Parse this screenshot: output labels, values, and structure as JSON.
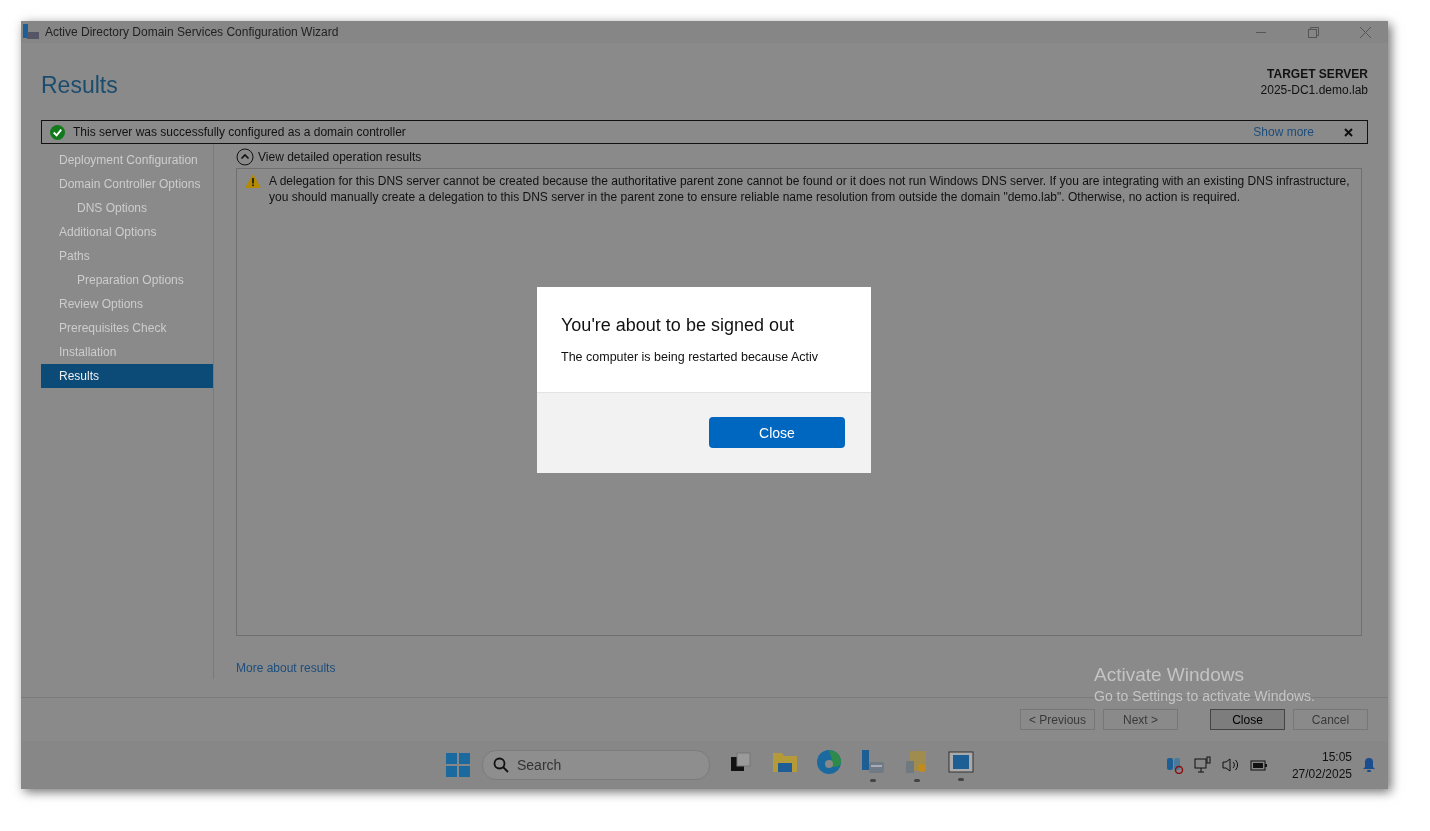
{
  "window": {
    "title": "Active Directory Domain Services Configuration Wizard"
  },
  "header": {
    "title": "Results",
    "target_label": "TARGET SERVER",
    "target_value": "2025-DC1.demo.lab"
  },
  "banner": {
    "text": "This server was successfully configured as a domain controller",
    "link": "Show more"
  },
  "steps": [
    {
      "label": "Deployment Configuration",
      "selected": false
    },
    {
      "label": "Domain Controller Options",
      "selected": false,
      "children": [
        {
          "label": "DNS Options",
          "selected": false
        }
      ]
    },
    {
      "label": "Additional Options",
      "selected": false
    },
    {
      "label": "Paths",
      "selected": false,
      "children": [
        {
          "label": "Preparation Options",
          "selected": false
        }
      ]
    },
    {
      "label": "Review Options",
      "selected": false
    },
    {
      "label": "Prerequisites Check",
      "selected": false
    },
    {
      "label": "Installation",
      "selected": false
    },
    {
      "label": "Results",
      "selected": true
    }
  ],
  "details": {
    "toggle": "View detailed operation results",
    "expanded": true,
    "messages": [
      {
        "kind": "warning",
        "text": "A delegation for this DNS server cannot be created because the authoritative parent zone cannot be found or it does not run Windows DNS server. If you are integrating with an existing DNS infrastructure, you should manually create a delegation to this DNS server in the parent zone to ensure reliable name resolution from outside the domain \"demo.lab\". Otherwise, no action is required."
      }
    ],
    "more_link": "More about results"
  },
  "buttons": [
    {
      "label": "< Previous",
      "disabled": true
    },
    {
      "label": "Next >",
      "disabled": true
    },
    {
      "label": "Close",
      "disabled": false
    },
    {
      "label": "Cancel",
      "disabled": true
    }
  ],
  "activation": {
    "title": "Activate Windows",
    "subtitle": "Go to Settings to activate Windows."
  },
  "dialog": {
    "title": "You're about to be signed out",
    "message": "The computer is being restarted because Activ",
    "button": "Close"
  },
  "taskbar": {
    "search_placeholder": "Search",
    "apps": [
      {
        "kind": "taskview",
        "running": false
      },
      {
        "kind": "folder",
        "running": false
      },
      {
        "kind": "browser",
        "running": false
      },
      {
        "kind": "server",
        "running": true
      },
      {
        "kind": "tools",
        "running": true
      },
      {
        "kind": "window",
        "running": true
      }
    ],
    "time": "15:05",
    "date": "27/02/2025"
  }
}
